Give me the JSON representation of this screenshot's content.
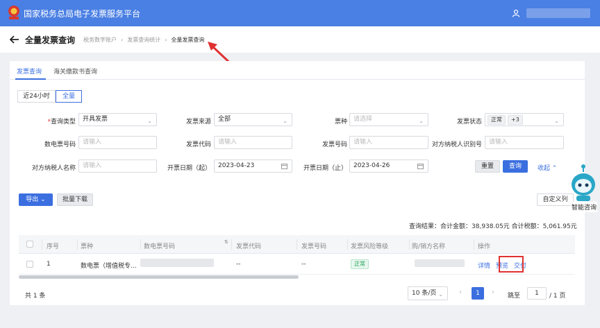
{
  "app": {
    "title": "国家税务总局电子发票服务平台",
    "user_name": ""
  },
  "header": {
    "page_title": "全量发票查询",
    "breadcrumb": [
      "税务数字账户",
      "发票查询统计",
      "全量发票查询"
    ],
    "separator": "›"
  },
  "tabs": [
    {
      "label": "发票查询",
      "active": true
    },
    {
      "label": "海关缴款书查询",
      "active": false
    }
  ],
  "range_toggle": [
    {
      "label": "近24小时",
      "active": false
    },
    {
      "label": "全量",
      "active": true
    }
  ],
  "form": {
    "query_type": {
      "label": "查询类型",
      "required": "*",
      "value": "开具发票"
    },
    "invoice_source": {
      "label": "发票来源",
      "value": "全部"
    },
    "invoice_kind": {
      "label": "票种",
      "placeholder": "请选择"
    },
    "invoice_status": {
      "label": "发票状态",
      "tag": "正常",
      "more": "+3"
    },
    "digital_no": {
      "label": "数电票号码",
      "placeholder": "请输入"
    },
    "invoice_code": {
      "label": "发票代码",
      "placeholder": "请输入"
    },
    "invoice_no": {
      "label": "发票号码",
      "placeholder": "请输入"
    },
    "counterparty_tax_id": {
      "label": "对方纳税人识别号",
      "placeholder": "请输入"
    },
    "counterparty_name": {
      "label": "对方纳税人名称",
      "placeholder": "请输入"
    },
    "date_start": {
      "label": "开票日期（起）",
      "value": "2023-04-23"
    },
    "date_end": {
      "label": "开票日期（止）",
      "value": "2023-04-26"
    },
    "reset_label": "重置",
    "query_label": "查询",
    "collapse_label": "收起"
  },
  "toolbar": {
    "export_label": "导出",
    "batch_download_label": "批量下载",
    "customize_label": "自定义列"
  },
  "summary": {
    "text": "查询结果：合计金额：38,938.05元    合计税额：5,061.95元"
  },
  "table": {
    "columns": [
      "序号",
      "票种",
      "数电票号码",
      "发票代码",
      "发票号码",
      "发票风险等级",
      "购/销方名称",
      "操作"
    ],
    "rows": [
      {
        "index": "1",
        "kind": "数电票（增值税专...",
        "invoice_code": "--",
        "invoice_no": "--",
        "risk": "正常",
        "actions": [
          "详情",
          "预览",
          "交付"
        ]
      }
    ]
  },
  "pagination": {
    "total": "共 1 条",
    "page_size": "10 条/页",
    "current_page": "1",
    "jump_label": "跳至",
    "jump_value": "1",
    "total_pages": "/ 1 页"
  },
  "assistant": {
    "label": "智能咨询"
  },
  "colors": {
    "primary": "#3b6fe0",
    "topbar": "#4a7fe3",
    "highlight": "#e03131"
  }
}
